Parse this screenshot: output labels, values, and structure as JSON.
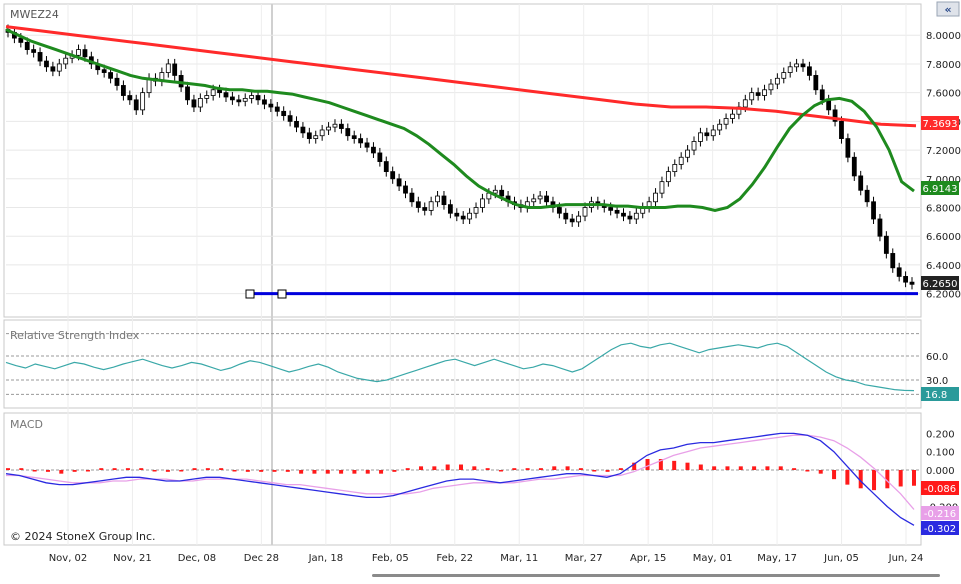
{
  "chart_data": {
    "type": "candlestick",
    "symbol": "MWEZ24",
    "ylim": [
      6.1,
      8.12
    ],
    "price_ticks": [
      "8.0000",
      "7.8000",
      "7.6000",
      "7.4000",
      "7.2000",
      "7.0000",
      "6.8000",
      "6.6000",
      "6.4000",
      "6.2000"
    ],
    "x_labels": [
      "Nov, 02",
      "Nov, 21",
      "Dec, 08",
      "Dec 28",
      "Jan, 18",
      "Feb, 05",
      "Feb, 22",
      "Mar, 11",
      "Mar, 27",
      "Apr, 15",
      "May, 01",
      "May, 17",
      "Jun, 05",
      "Jun, 24"
    ],
    "last_values": {
      "ma_200": "7.3693",
      "ma_20": "6.9143",
      "close": "6.2650",
      "rsi": "16.8",
      "macd_hist": "-0.086",
      "macd_signal": "-0.216",
      "macd_line": "-0.302"
    },
    "closes": [
      8.02,
      7.98,
      7.95,
      7.9,
      7.88,
      7.82,
      7.78,
      7.75,
      7.8,
      7.84,
      7.86,
      7.9,
      7.85,
      7.8,
      7.76,
      7.74,
      7.7,
      7.65,
      7.58,
      7.55,
      7.48,
      7.6,
      7.7,
      7.68,
      7.74,
      7.8,
      7.72,
      7.64,
      7.55,
      7.5,
      7.56,
      7.58,
      7.62,
      7.6,
      7.57,
      7.55,
      7.54,
      7.56,
      7.58,
      7.55,
      7.52,
      7.5,
      7.47,
      7.44,
      7.4,
      7.36,
      7.32,
      7.28,
      7.3,
      7.34,
      7.36,
      7.38,
      7.35,
      7.3,
      7.28,
      7.25,
      7.22,
      7.18,
      7.12,
      7.05,
      7.0,
      6.95,
      6.9,
      6.84,
      6.8,
      6.78,
      6.84,
      6.88,
      6.82,
      6.76,
      6.74,
      6.72,
      6.76,
      6.8,
      6.86,
      6.9,
      6.92,
      6.88,
      6.84,
      6.82,
      6.8,
      6.84,
      6.86,
      6.88,
      6.84,
      6.8,
      6.76,
      6.72,
      6.7,
      6.74,
      6.8,
      6.84,
      6.82,
      6.8,
      6.78,
      6.76,
      6.74,
      6.72,
      6.76,
      6.8,
      6.84,
      6.9,
      6.98,
      7.05,
      7.1,
      7.15,
      7.2,
      7.26,
      7.32,
      7.3,
      7.34,
      7.38,
      7.42,
      7.45,
      7.5,
      7.55,
      7.6,
      7.58,
      7.62,
      7.66,
      7.7,
      7.74,
      7.78,
      7.8,
      7.78,
      7.72,
      7.62,
      7.55,
      7.48,
      7.4,
      7.28,
      7.15,
      7.02,
      6.92,
      6.84,
      6.72,
      6.6,
      6.48,
      6.38,
      6.32,
      6.28,
      6.265
    ],
    "ma_20": [
      8.04,
      8.0,
      7.96,
      7.93,
      7.9,
      7.87,
      7.84,
      7.81,
      7.78,
      7.75,
      7.72,
      7.7,
      7.69,
      7.68,
      7.67,
      7.66,
      7.65,
      7.63,
      7.62,
      7.62,
      7.61,
      7.61,
      7.6,
      7.59,
      7.57,
      7.55,
      7.53,
      7.5,
      7.47,
      7.44,
      7.41,
      7.38,
      7.35,
      7.3,
      7.24,
      7.17,
      7.1,
      7.02,
      6.95,
      6.9,
      6.86,
      6.82,
      6.8,
      6.8,
      6.81,
      6.82,
      6.82,
      6.82,
      6.82,
      6.81,
      6.81,
      6.8,
      6.8,
      6.8,
      6.81,
      6.81,
      6.8,
      6.78,
      6.8,
      6.86,
      6.96,
      7.08,
      7.22,
      7.35,
      7.44,
      7.51,
      7.55,
      7.56,
      7.54,
      7.47,
      7.36,
      7.2,
      6.98,
      6.9143
    ],
    "ma_200": [
      8.06,
      8.03,
      8.0,
      7.97,
      7.94,
      7.91,
      7.88,
      7.85,
      7.82,
      7.79,
      7.76,
      7.73,
      7.7,
      7.67,
      7.64,
      7.61,
      7.58,
      7.55,
      7.52,
      7.5,
      7.5,
      7.49,
      7.47,
      7.44,
      7.41,
      7.38,
      7.3693
    ],
    "rsi": [
      52,
      48,
      45,
      50,
      47,
      44,
      48,
      52,
      50,
      46,
      43,
      46,
      50,
      53,
      56,
      52,
      48,
      45,
      48,
      52,
      50,
      46,
      42,
      45,
      50,
      54,
      52,
      48,
      44,
      40,
      43,
      47,
      50,
      46,
      40,
      36,
      32,
      30,
      28,
      30,
      34,
      38,
      42,
      46,
      50,
      54,
      56,
      52,
      48,
      52,
      56,
      52,
      48,
      44,
      46,
      50,
      48,
      44,
      40,
      44,
      52,
      60,
      68,
      74,
      76,
      72,
      70,
      74,
      76,
      72,
      68,
      64,
      68,
      70,
      72,
      74,
      72,
      70,
      74,
      76,
      72,
      64,
      56,
      48,
      40,
      34,
      30,
      28,
      24,
      22,
      20,
      18,
      17,
      16.8
    ],
    "macd_line": [
      -0.02,
      -0.03,
      -0.05,
      -0.07,
      -0.08,
      -0.08,
      -0.07,
      -0.06,
      -0.05,
      -0.04,
      -0.04,
      -0.05,
      -0.06,
      -0.06,
      -0.05,
      -0.04,
      -0.04,
      -0.05,
      -0.06,
      -0.07,
      -0.08,
      -0.09,
      -0.1,
      -0.11,
      -0.12,
      -0.13,
      -0.14,
      -0.15,
      -0.15,
      -0.14,
      -0.12,
      -0.1,
      -0.08,
      -0.06,
      -0.05,
      -0.05,
      -0.06,
      -0.07,
      -0.06,
      -0.05,
      -0.04,
      -0.03,
      -0.02,
      -0.02,
      -0.03,
      -0.04,
      -0.02,
      0.03,
      0.08,
      0.11,
      0.12,
      0.14,
      0.15,
      0.15,
      0.16,
      0.17,
      0.18,
      0.19,
      0.2,
      0.2,
      0.19,
      0.16,
      0.1,
      0.02,
      -0.06,
      -0.13,
      -0.2,
      -0.26,
      -0.302
    ],
    "macd_signal": [
      -0.03,
      -0.03,
      -0.04,
      -0.05,
      -0.06,
      -0.07,
      -0.07,
      -0.07,
      -0.06,
      -0.06,
      -0.05,
      -0.05,
      -0.05,
      -0.06,
      -0.06,
      -0.05,
      -0.05,
      -0.05,
      -0.05,
      -0.06,
      -0.07,
      -0.08,
      -0.08,
      -0.09,
      -0.1,
      -0.11,
      -0.12,
      -0.13,
      -0.13,
      -0.13,
      -0.13,
      -0.12,
      -0.1,
      -0.09,
      -0.08,
      -0.07,
      -0.07,
      -0.07,
      -0.07,
      -0.06,
      -0.05,
      -0.05,
      -0.04,
      -0.03,
      -0.03,
      -0.03,
      -0.03,
      -0.01,
      0.02,
      0.05,
      0.08,
      0.1,
      0.12,
      0.13,
      0.14,
      0.15,
      0.16,
      0.17,
      0.18,
      0.19,
      0.19,
      0.18,
      0.16,
      0.12,
      0.07,
      0.01,
      -0.06,
      -0.13,
      -0.216
    ],
    "macd_hist": [
      0.01,
      0.01,
      0.0,
      -0.01,
      -0.02,
      -0.01,
      0.0,
      0.01,
      0.01,
      0.01,
      0.01,
      0.0,
      -0.01,
      0.0,
      0.01,
      0.01,
      0.01,
      0.0,
      -0.01,
      -0.01,
      -0.01,
      -0.01,
      -0.02,
      -0.02,
      -0.02,
      -0.02,
      -0.02,
      -0.02,
      -0.02,
      -0.01,
      0.01,
      0.02,
      0.02,
      0.03,
      0.03,
      0.02,
      0.01,
      0.0,
      0.01,
      0.01,
      0.01,
      0.02,
      0.02,
      0.01,
      0.0,
      -0.01,
      0.01,
      0.04,
      0.06,
      0.06,
      0.05,
      0.04,
      0.03,
      0.02,
      0.02,
      0.02,
      0.02,
      0.02,
      0.02,
      0.01,
      0.0,
      -0.02,
      -0.05,
      -0.08,
      -0.1,
      -0.11,
      -0.1,
      -0.09,
      -0.086
    ],
    "rsi_ticks": [
      "60.0",
      "30.0"
    ],
    "macd_ticks": [
      "0.200",
      "0.100",
      "0.000",
      "-0.100",
      "-0.200"
    ],
    "support_line": 6.2
  },
  "labels": {
    "symbol": "MWEZ24",
    "rsi_title": "Relative Strength Index",
    "macd_title": "MACD",
    "copyright": "© 2024 StoneX Group Inc."
  },
  "colors": {
    "ma_200": "#ff2a2a",
    "ma_20": "#1e8a1e",
    "rsi_line": "#3aa8a8",
    "rsi_badge": "#2a9a9a",
    "macd_line": "#2a2ae0",
    "macd_signal": "#e8a0e8",
    "macd_hist": "#ff1a1a",
    "support": "#0000dd",
    "close_badge": "#222222"
  }
}
